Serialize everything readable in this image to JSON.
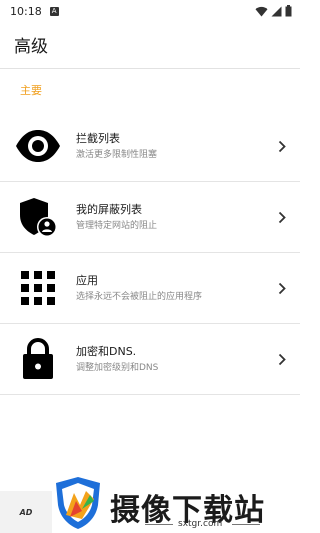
{
  "status": {
    "time": "10:18",
    "notif_glyph": "A"
  },
  "app_bar": {
    "title": "高级"
  },
  "section": {
    "label": "主要"
  },
  "items": [
    {
      "title": "拦截列表",
      "subtitle": "激活更多限制性阻塞",
      "icon": "eye-icon"
    },
    {
      "title": "我的屏蔽列表",
      "subtitle": "管理特定网站的阻止",
      "icon": "shield-user-icon"
    },
    {
      "title": "应用",
      "subtitle": "选择永远不会被阻止的应用程序",
      "icon": "apps-grid-icon"
    },
    {
      "title": "加密和DNS.",
      "subtitle": "调整加密级别和DNS",
      "icon": "lock-icon"
    }
  ],
  "ad": {
    "label": "AD"
  },
  "watermark": {
    "text": "摄像下载站",
    "url": "sxtgr.com"
  },
  "colors": {
    "accent": "#f0a020",
    "divider": "#e4e4e4",
    "icon": "#000000"
  }
}
